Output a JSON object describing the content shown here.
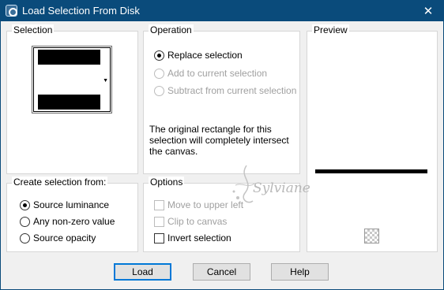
{
  "window": {
    "title": "Load Selection From Disk",
    "close_glyph": "✕"
  },
  "selection_group": {
    "label": "Selection"
  },
  "operation_group": {
    "label": "Operation",
    "options": [
      {
        "label": "Replace selection",
        "selected": true,
        "enabled": true
      },
      {
        "label": "Add to current selection",
        "selected": false,
        "enabled": false
      },
      {
        "label": "Subtract from current selection",
        "selected": false,
        "enabled": false
      }
    ],
    "info": "The original rectangle for this selection will completely intersect the canvas."
  },
  "preview_group": {
    "label": "Preview"
  },
  "create_group": {
    "label": "Create selection from:",
    "options": [
      {
        "label": "Source luminance",
        "selected": true
      },
      {
        "label": "Any non-zero value",
        "selected": false
      },
      {
        "label": "Source opacity",
        "selected": false
      }
    ]
  },
  "options_group": {
    "label": "Options",
    "checks": [
      {
        "label": "Move to upper left",
        "checked": false,
        "enabled": false
      },
      {
        "label": "Clip to canvas",
        "checked": false,
        "enabled": false
      },
      {
        "label": "Invert selection",
        "checked": false,
        "enabled": true
      }
    ]
  },
  "watermark": "Sylviane",
  "buttons": {
    "load": "Load",
    "cancel": "Cancel",
    "help": "Help"
  },
  "colors": {
    "titlebar": "#0a4b7b",
    "default_button_border": "#0078d7",
    "disabled_text": "#a0a0a0"
  }
}
